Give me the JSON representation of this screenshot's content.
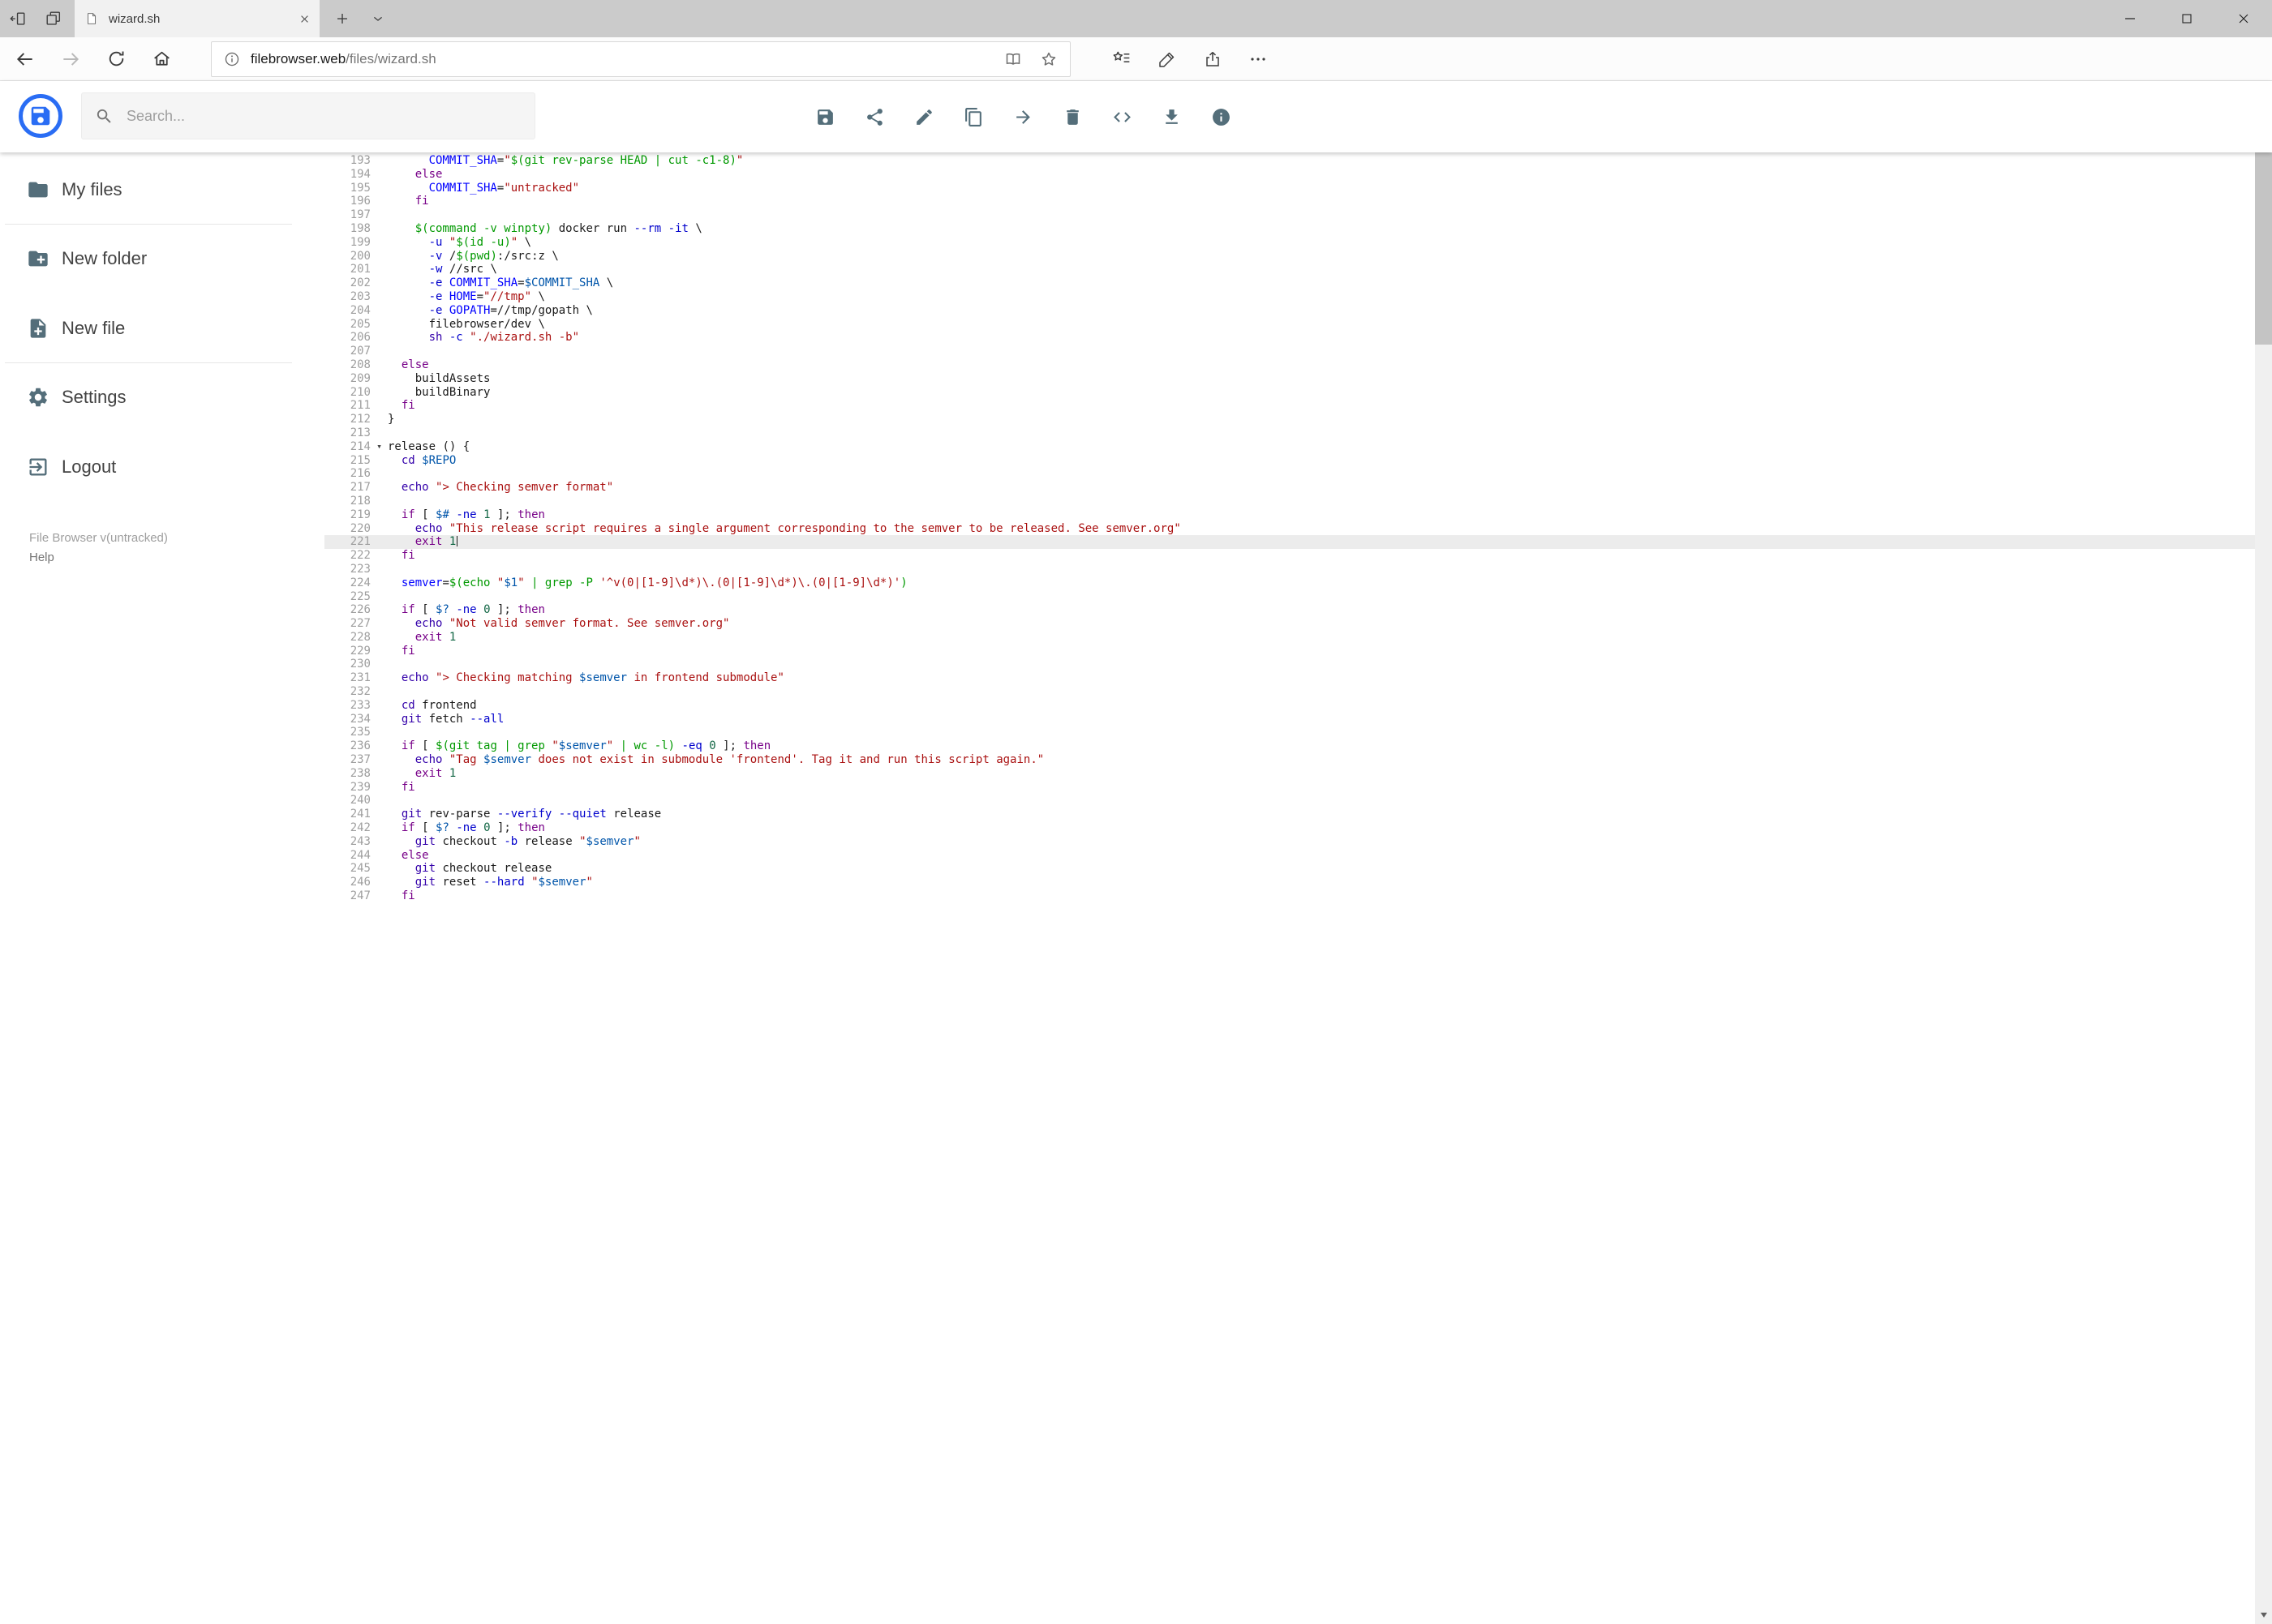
{
  "browser": {
    "tab_title": "wizard.sh",
    "url": {
      "domain": "filebrowser.web",
      "path": "/files/wizard.sh"
    }
  },
  "app": {
    "search_placeholder": "Search...",
    "toolbar_icons": [
      "save",
      "share",
      "edit",
      "copy",
      "move",
      "delete",
      "code",
      "download",
      "info"
    ],
    "sidebar": {
      "items": [
        {
          "label": "My files",
          "icon": "folder-icon"
        },
        {
          "label": "New folder",
          "icon": "create-new-folder-icon"
        },
        {
          "label": "New file",
          "icon": "new-file-icon"
        },
        {
          "label": "Settings",
          "icon": "settings-icon"
        },
        {
          "label": "Logout",
          "icon": "logout-icon"
        }
      ],
      "footer": {
        "version": "File Browser v(untracked)",
        "help": "Help"
      }
    }
  },
  "editor": {
    "language": "shell",
    "first_line_number": 193,
    "active_line_number": 221,
    "fold_marker_line_number": 214,
    "lines": [
      "      COMMIT_SHA=\"$(git rev-parse HEAD | cut -c1-8)\"",
      "    else",
      "      COMMIT_SHA=\"untracked\"",
      "    fi",
      "",
      "    $(command -v winpty) docker run --rm -it \\",
      "      -u \"$(id -u)\" \\",
      "      -v /$(pwd):/src:z \\",
      "      -w //src \\",
      "      -e COMMIT_SHA=$COMMIT_SHA \\",
      "      -e HOME=\"//tmp\" \\",
      "      -e GOPATH=//tmp/gopath \\",
      "      filebrowser/dev \\",
      "      sh -c \"./wizard.sh -b\"",
      "",
      "  else",
      "    buildAssets",
      "    buildBinary",
      "  fi",
      "}",
      "",
      "release () {",
      "  cd $REPO",
      "",
      "  echo \"> Checking semver format\"",
      "",
      "  if [ $# -ne 1 ]; then",
      "    echo \"This release script requires a single argument corresponding to the semver to be released. See semver.org\"",
      "    exit 1",
      "  fi",
      "",
      "  semver=$(echo \"$1\" | grep -P '^v(0|[1-9]\\d*)\\.(0|[1-9]\\d*)\\.(0|[1-9]\\d*)')",
      "",
      "  if [ $? -ne 0 ]; then",
      "    echo \"Not valid semver format. See semver.org\"",
      "    exit 1",
      "  fi",
      "",
      "  echo \"> Checking matching $semver in frontend submodule\"",
      "",
      "  cd frontend",
      "  git fetch --all",
      "",
      "  if [ $(git tag | grep \"$semver\" | wc -l) -eq 0 ]; then",
      "    echo \"Tag $semver does not exist in submodule 'frontend'. Tag it and run this script again.\"",
      "    exit 1",
      "  fi",
      "",
      "  git rev-parse --verify --quiet release",
      "  if [ $? -ne 0 ]; then",
      "    git checkout -b release \"$semver\"",
      "  else",
      "    git checkout release",
      "    git reset --hard \"$semver\"",
      "  fi"
    ]
  },
  "colors": {
    "logo_blue": "#2a6df4",
    "active_line_bg": "#ececec",
    "syntax": {
      "keyword": "#770088",
      "builtin": "#3300aa",
      "string": "#aa1111",
      "substitution": "#009900",
      "variable": "#0055aa",
      "definition": "#0000ff",
      "flag": "#0000cc",
      "number": "#116644"
    }
  }
}
